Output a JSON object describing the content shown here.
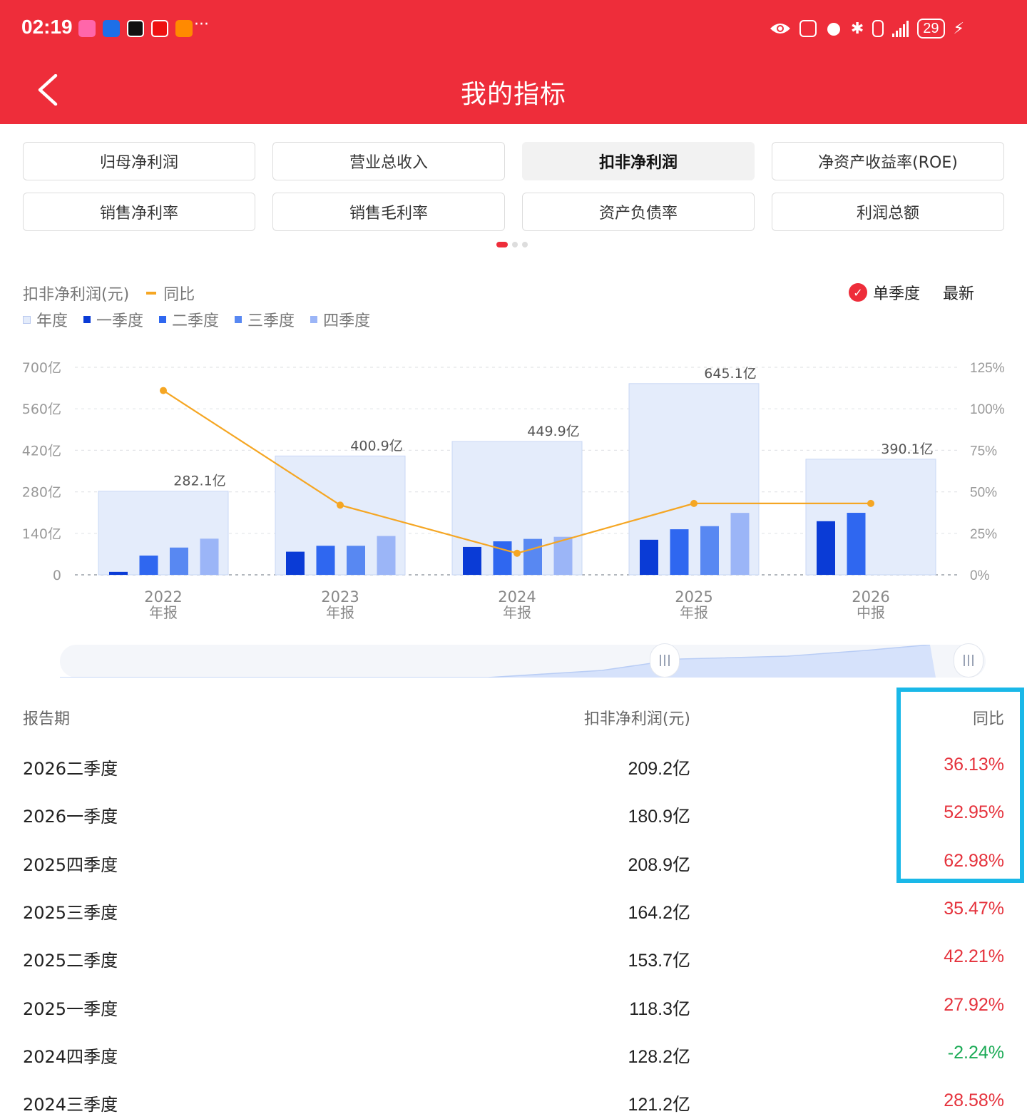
{
  "status_bar": {
    "time": "02:19",
    "more": "···",
    "battery": "29"
  },
  "header": {
    "title": "我的指标"
  },
  "tabs": [
    {
      "label": "归母净利润"
    },
    {
      "label": "营业总收入"
    },
    {
      "label": "扣非净利润",
      "active": true
    },
    {
      "label": "净资产收益率(ROE)"
    },
    {
      "label": "销售净利率"
    },
    {
      "label": "销售毛利率"
    },
    {
      "label": "资产负债率"
    },
    {
      "label": "利润总额"
    }
  ],
  "legend": {
    "metric": "扣非净利润(元)",
    "yoy": "同比",
    "annual": "年度",
    "q1": "一季度",
    "q2": "二季度",
    "q3": "三季度",
    "q4": "四季度",
    "single_quarter": "单季度",
    "latest": "最新"
  },
  "colors": {
    "header": "#EE2D3A",
    "annual": "#E4ECFB",
    "q1": "#0A3BD6",
    "q2": "#2F67F0",
    "q3": "#5888F2",
    "q4": "#9BB5F7",
    "yoy_line": "#F5A623",
    "positive": "#E5323C",
    "negative": "#1AAA55",
    "highlight": "#1AB8E8"
  },
  "chart_data": {
    "type": "bar",
    "categories": [
      [
        "2022",
        "年报"
      ],
      [
        "2023",
        "年报"
      ],
      [
        "2024",
        "年报"
      ],
      [
        "2025",
        "年报"
      ],
      [
        "2026",
        "中报"
      ]
    ],
    "series": [
      {
        "name": "年度",
        "values": [
          282.1,
          400.9,
          449.9,
          645.1,
          390.1
        ],
        "labels": [
          "282.1亿",
          "400.9亿",
          "449.9亿",
          "645.1亿",
          "390.1亿"
        ]
      },
      {
        "name": "一季度",
        "values": [
          10,
          78,
          94,
          118.3,
          180.9
        ]
      },
      {
        "name": "二季度",
        "values": [
          65,
          98,
          113,
          153.7,
          209.2
        ]
      },
      {
        "name": "三季度",
        "values": [
          92,
          98,
          121.2,
          164.2,
          null
        ]
      },
      {
        "name": "四季度",
        "values": [
          122,
          131,
          128.2,
          208.9,
          null
        ]
      },
      {
        "name": "同比",
        "axis": "right",
        "values": [
          111,
          42,
          13,
          43,
          43
        ]
      }
    ],
    "y_left": {
      "ticks": [
        "700亿",
        "560亿",
        "420亿",
        "280亿",
        "140亿",
        "0"
      ],
      "range": [
        0,
        700
      ]
    },
    "y_right": {
      "ticks": [
        "125%",
        "100%",
        "75%",
        "50%",
        "25%",
        "0%"
      ],
      "range": [
        0,
        125
      ]
    },
    "grid": true
  },
  "table": {
    "headers": {
      "period": "报告期",
      "value": "扣非净利润(元)",
      "yoy": "同比"
    },
    "rows": [
      {
        "period": "2026二季度",
        "value": "209.2亿",
        "yoy": "36.13%",
        "sign": "pos"
      },
      {
        "period": "2026一季度",
        "value": "180.9亿",
        "yoy": "52.95%",
        "sign": "pos"
      },
      {
        "period": "2025四季度",
        "value": "208.9亿",
        "yoy": "62.98%",
        "sign": "pos"
      },
      {
        "period": "2025三季度",
        "value": "164.2亿",
        "yoy": "35.47%",
        "sign": "pos"
      },
      {
        "period": "2025二季度",
        "value": "153.7亿",
        "yoy": "42.21%",
        "sign": "pos"
      },
      {
        "period": "2025一季度",
        "value": "118.3亿",
        "yoy": "27.92%",
        "sign": "pos"
      },
      {
        "period": "2024四季度",
        "value": "128.2亿",
        "yoy": "-2.24%",
        "sign": "neg"
      },
      {
        "period": "2024三季度",
        "value": "121.2亿",
        "yoy": "28.58%",
        "sign": "pos"
      }
    ]
  }
}
